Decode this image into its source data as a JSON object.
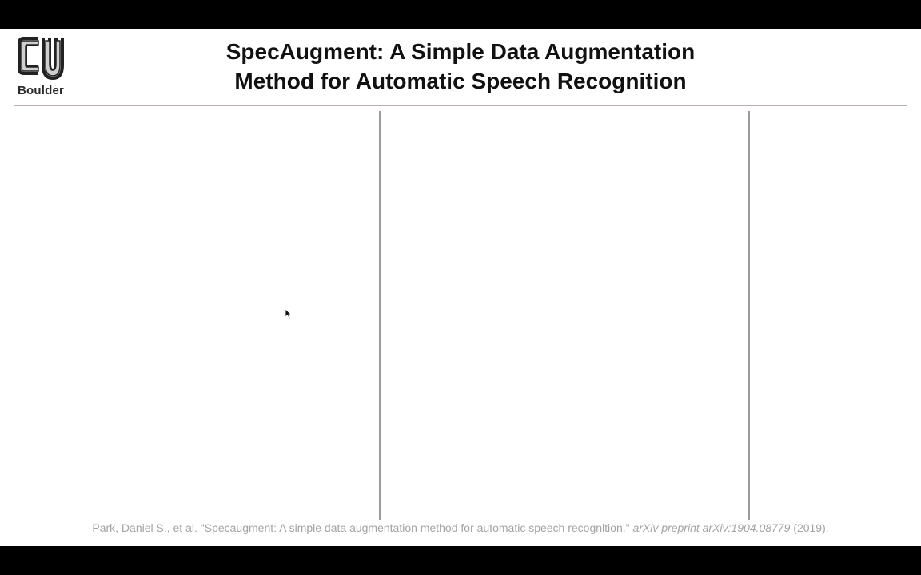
{
  "slide": {
    "logo": {
      "icon": "cu-logo-icon",
      "text": "Boulder"
    },
    "title": {
      "line1": "SpecAugment: A Simple Data Augmentation",
      "line2": "Method for Automatic Speech Recognition"
    },
    "citation": {
      "authors": "Park, Daniel S., et al.",
      "paper_title": "\"Specaugment: A simple data augmentation method for automatic speech recognition.\"",
      "venue": "arXiv preprint arXiv:1904.08779",
      "year": "(2019)."
    }
  },
  "colors": {
    "background": "#ffffff",
    "letterbox": "#000000",
    "rule": "#b9b0b4",
    "citation_text": "#a3a3a3"
  }
}
